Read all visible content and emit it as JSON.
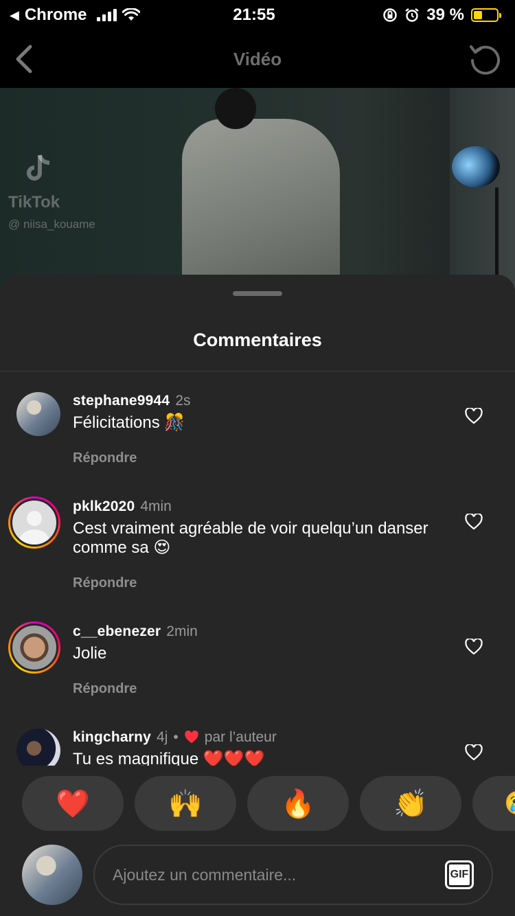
{
  "status_bar": {
    "back_app": "Chrome",
    "time": "21:55",
    "battery": "39 %",
    "battery_level": 0.39
  },
  "nav": {
    "title": "Vidéo",
    "back_icon": "chevron-left-icon",
    "refresh_icon": "refresh-icon"
  },
  "video": {
    "watermark_brand": "TikTok",
    "watermark_user": "@ niisa_kouame"
  },
  "sheet": {
    "title": "Commentaires"
  },
  "comments": [
    {
      "username": "stephane9944",
      "time": "2s",
      "text": "Félicitations 🎊",
      "reply": "Répondre"
    },
    {
      "username": "pklk2020",
      "time": "4min",
      "text": "Cest vraiment agréable de voir quelqu’un danser comme sa 😍",
      "reply": "Répondre"
    },
    {
      "username": "c__ebenezer",
      "time": "2min",
      "text": "Jolie",
      "reply": "Répondre"
    },
    {
      "username": "kingcharny",
      "time": "4j",
      "separator": "•",
      "by_author": "par l’auteur",
      "text": "Tu es magnifique ❤️❤️❤️"
    }
  ],
  "reactions": [
    "❤️",
    "🙌",
    "🔥",
    "👏",
    "😢"
  ],
  "composer": {
    "placeholder": "Ajoutez un commentaire...",
    "gif_label": "GIF"
  },
  "colors": {
    "background": "#000000",
    "sheet": "#262626",
    "muted": "#8e8e8e",
    "accent_red": "#ff3040"
  }
}
